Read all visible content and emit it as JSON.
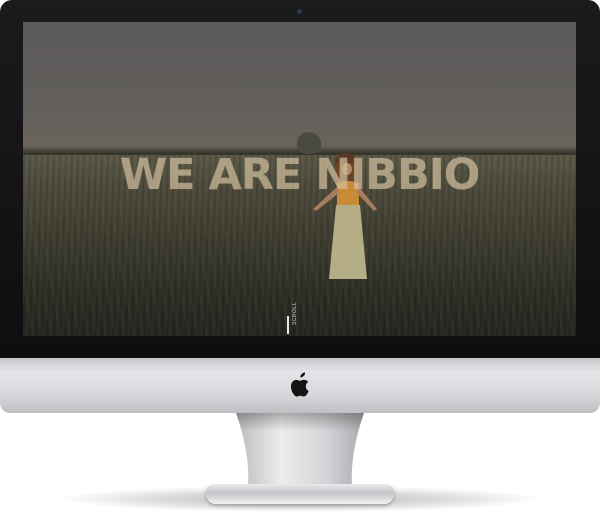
{
  "hero": {
    "title": "WE ARE NIBBIO"
  },
  "scroll_indicator": {
    "label": "SCROLL"
  },
  "device": {
    "type": "desktop monitor",
    "logo_icon": "apple-logo-icon"
  },
  "colors": {
    "bezel": "#111113",
    "aluminum": "#dcdde0",
    "title_overlay": "#ccb896"
  }
}
